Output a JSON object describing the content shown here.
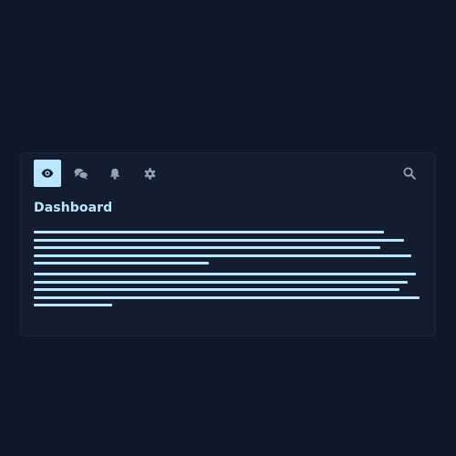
{
  "colors": {
    "background": "#0f172a",
    "card": "#141d30",
    "accent": "#bae6fd",
    "icon": "#94a3b8",
    "active_icon": "#0f172a"
  },
  "toolbar": {
    "icons": [
      "eye-icon",
      "chat-icon",
      "bell-icon",
      "gear-icon",
      "search-icon"
    ],
    "active": "eye-icon"
  },
  "main": {
    "title": "Dashboard"
  }
}
